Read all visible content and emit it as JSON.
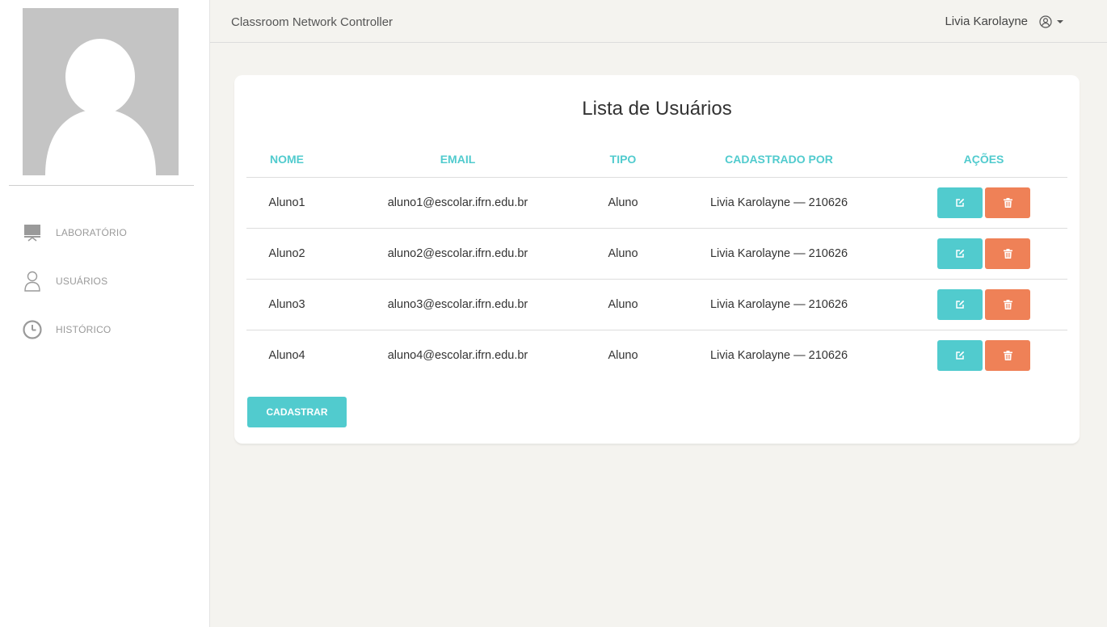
{
  "app": {
    "brand": "Classroom Network Controller",
    "user_name": "Livia Karolayne"
  },
  "sidebar": {
    "items": [
      {
        "label": "LABORATÓRIO",
        "icon": "monitor-icon"
      },
      {
        "label": "USUÁRIOS",
        "icon": "user-icon"
      },
      {
        "label": "HISTÓRICO",
        "icon": "clock-icon"
      }
    ]
  },
  "main": {
    "title": "Lista de Usuários",
    "columns": [
      "NOME",
      "EMAIL",
      "TIPO",
      "CADASTRADO POR",
      "AÇÕES"
    ],
    "rows": [
      {
        "nome": "Aluno1",
        "email": "aluno1@escolar.ifrn.edu.br",
        "tipo": "Aluno",
        "cadastrado_por": "Livia Karolayne — 210626"
      },
      {
        "nome": "Aluno2",
        "email": "aluno2@escolar.ifrn.edu.br",
        "tipo": "Aluno",
        "cadastrado_por": "Livia Karolayne — 210626"
      },
      {
        "nome": "Aluno3",
        "email": "aluno3@escolar.ifrn.edu.br",
        "tipo": "Aluno",
        "cadastrado_por": "Livia Karolayne — 210626"
      },
      {
        "nome": "Aluno4",
        "email": "aluno4@escolar.ifrn.edu.br",
        "tipo": "Aluno",
        "cadastrado_por": "Livia Karolayne — 210626"
      }
    ],
    "add_label": "CADASTRAR"
  },
  "colors": {
    "primary": "#51cbce",
    "danger": "#ef8157",
    "background": "#f4f3ef"
  }
}
